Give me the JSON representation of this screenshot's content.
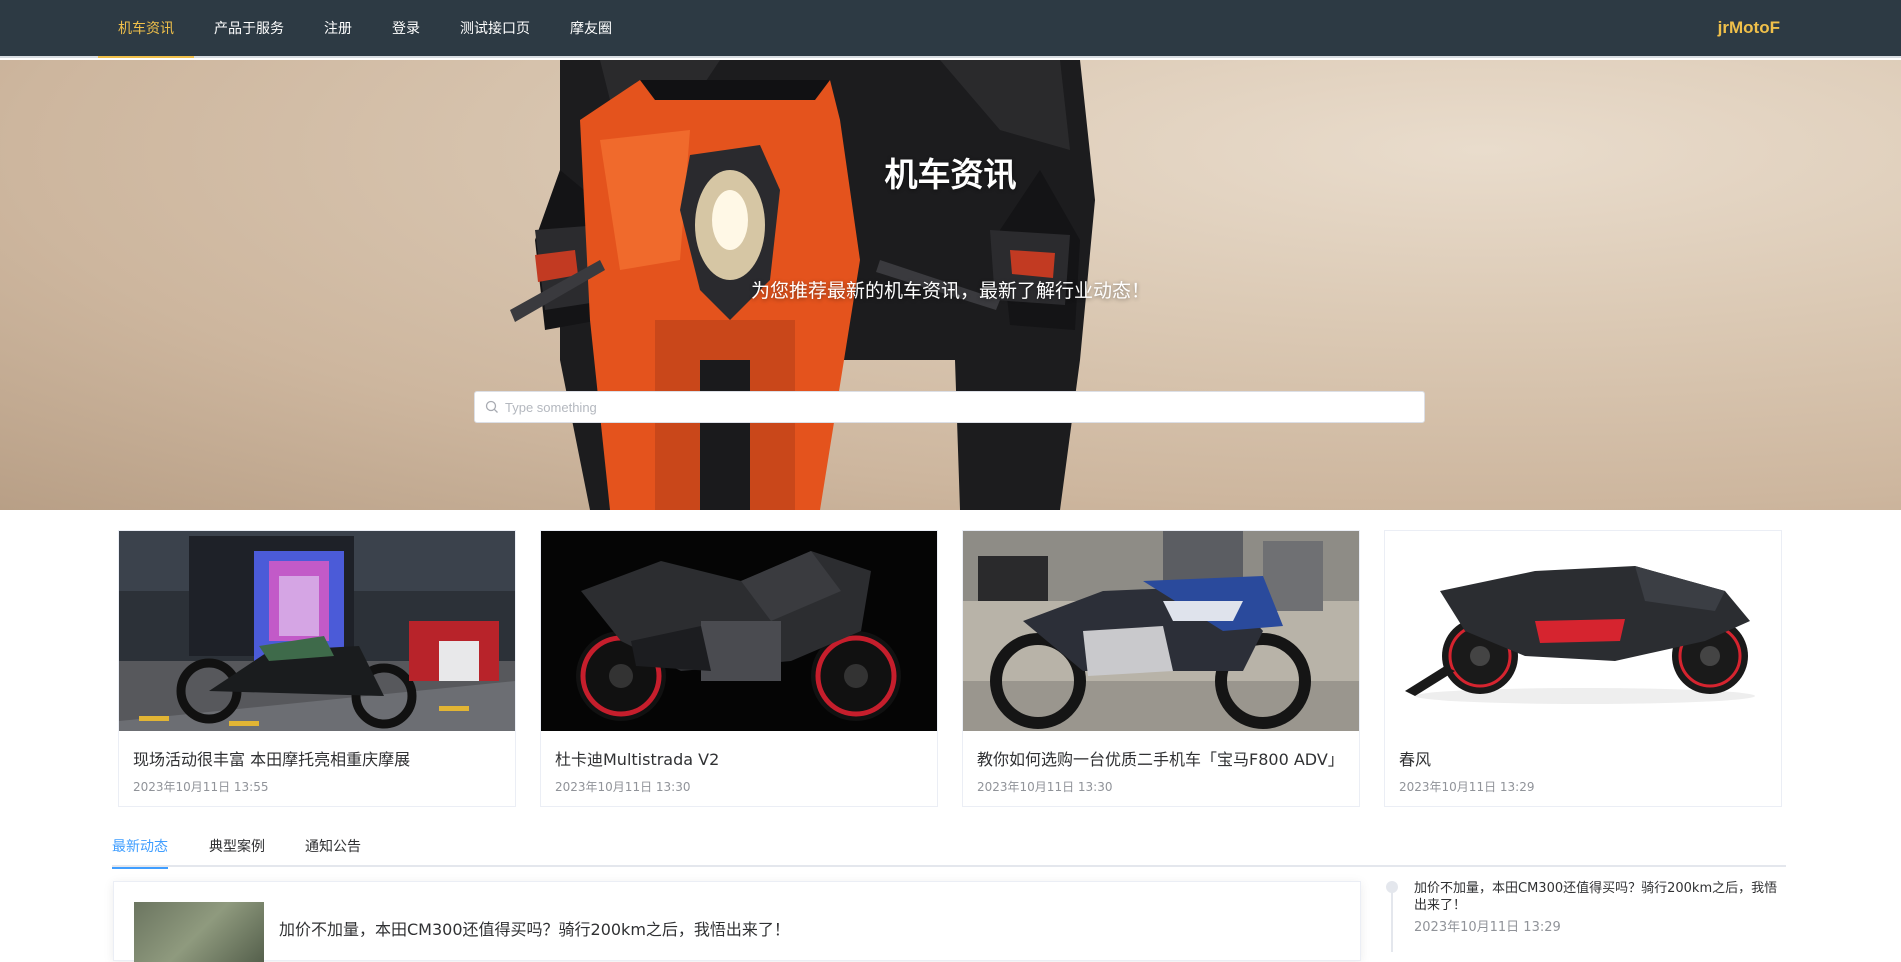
{
  "nav": {
    "items": [
      {
        "label": "机车资讯",
        "active": true
      },
      {
        "label": "产品于服务",
        "active": false
      },
      {
        "label": "注册",
        "active": false
      },
      {
        "label": "登录",
        "active": false
      },
      {
        "label": "测试接口页",
        "active": false
      },
      {
        "label": "摩友圈",
        "active": false
      }
    ],
    "brand": "jrMotoF",
    "active_color": "#f0c04a"
  },
  "hero": {
    "title": "机车资讯",
    "subtitle": "为您推荐最新的机车资讯，最新了解行业动态！",
    "search": {
      "placeholder": "Type something",
      "value": "",
      "icon": "search-icon"
    }
  },
  "cards": [
    {
      "title": "现场活动很丰富 本田摩托亮相重庆摩展",
      "date": "2023年10月11日 13:55"
    },
    {
      "title": "杜卡迪Multistrada V2",
      "date": "2023年10月11日 13:30"
    },
    {
      "title": "教你如何选购一台优质二手机车「宝马F800 ADV」",
      "date": "2023年10月11日 13:30"
    },
    {
      "title": "春风",
      "date": "2023年10月11日 13:29"
    }
  ],
  "tabs": [
    {
      "label": "最新动态",
      "active": true
    },
    {
      "label": "典型案例",
      "active": false
    },
    {
      "label": "通知公告",
      "active": false
    }
  ],
  "news": [
    {
      "title": "加价不加量，本田CM300还值得买吗？骑行200km之后，我悟出来了！"
    }
  ],
  "timeline": [
    {
      "text": "加价不加量，本田CM300还值得买吗？骑行200km之后，我悟出来了！",
      "date": "2023年10月11日 13:29"
    }
  ],
  "colors": {
    "nav_bg": "#2d3a44",
    "tab_active": "#409eff"
  }
}
